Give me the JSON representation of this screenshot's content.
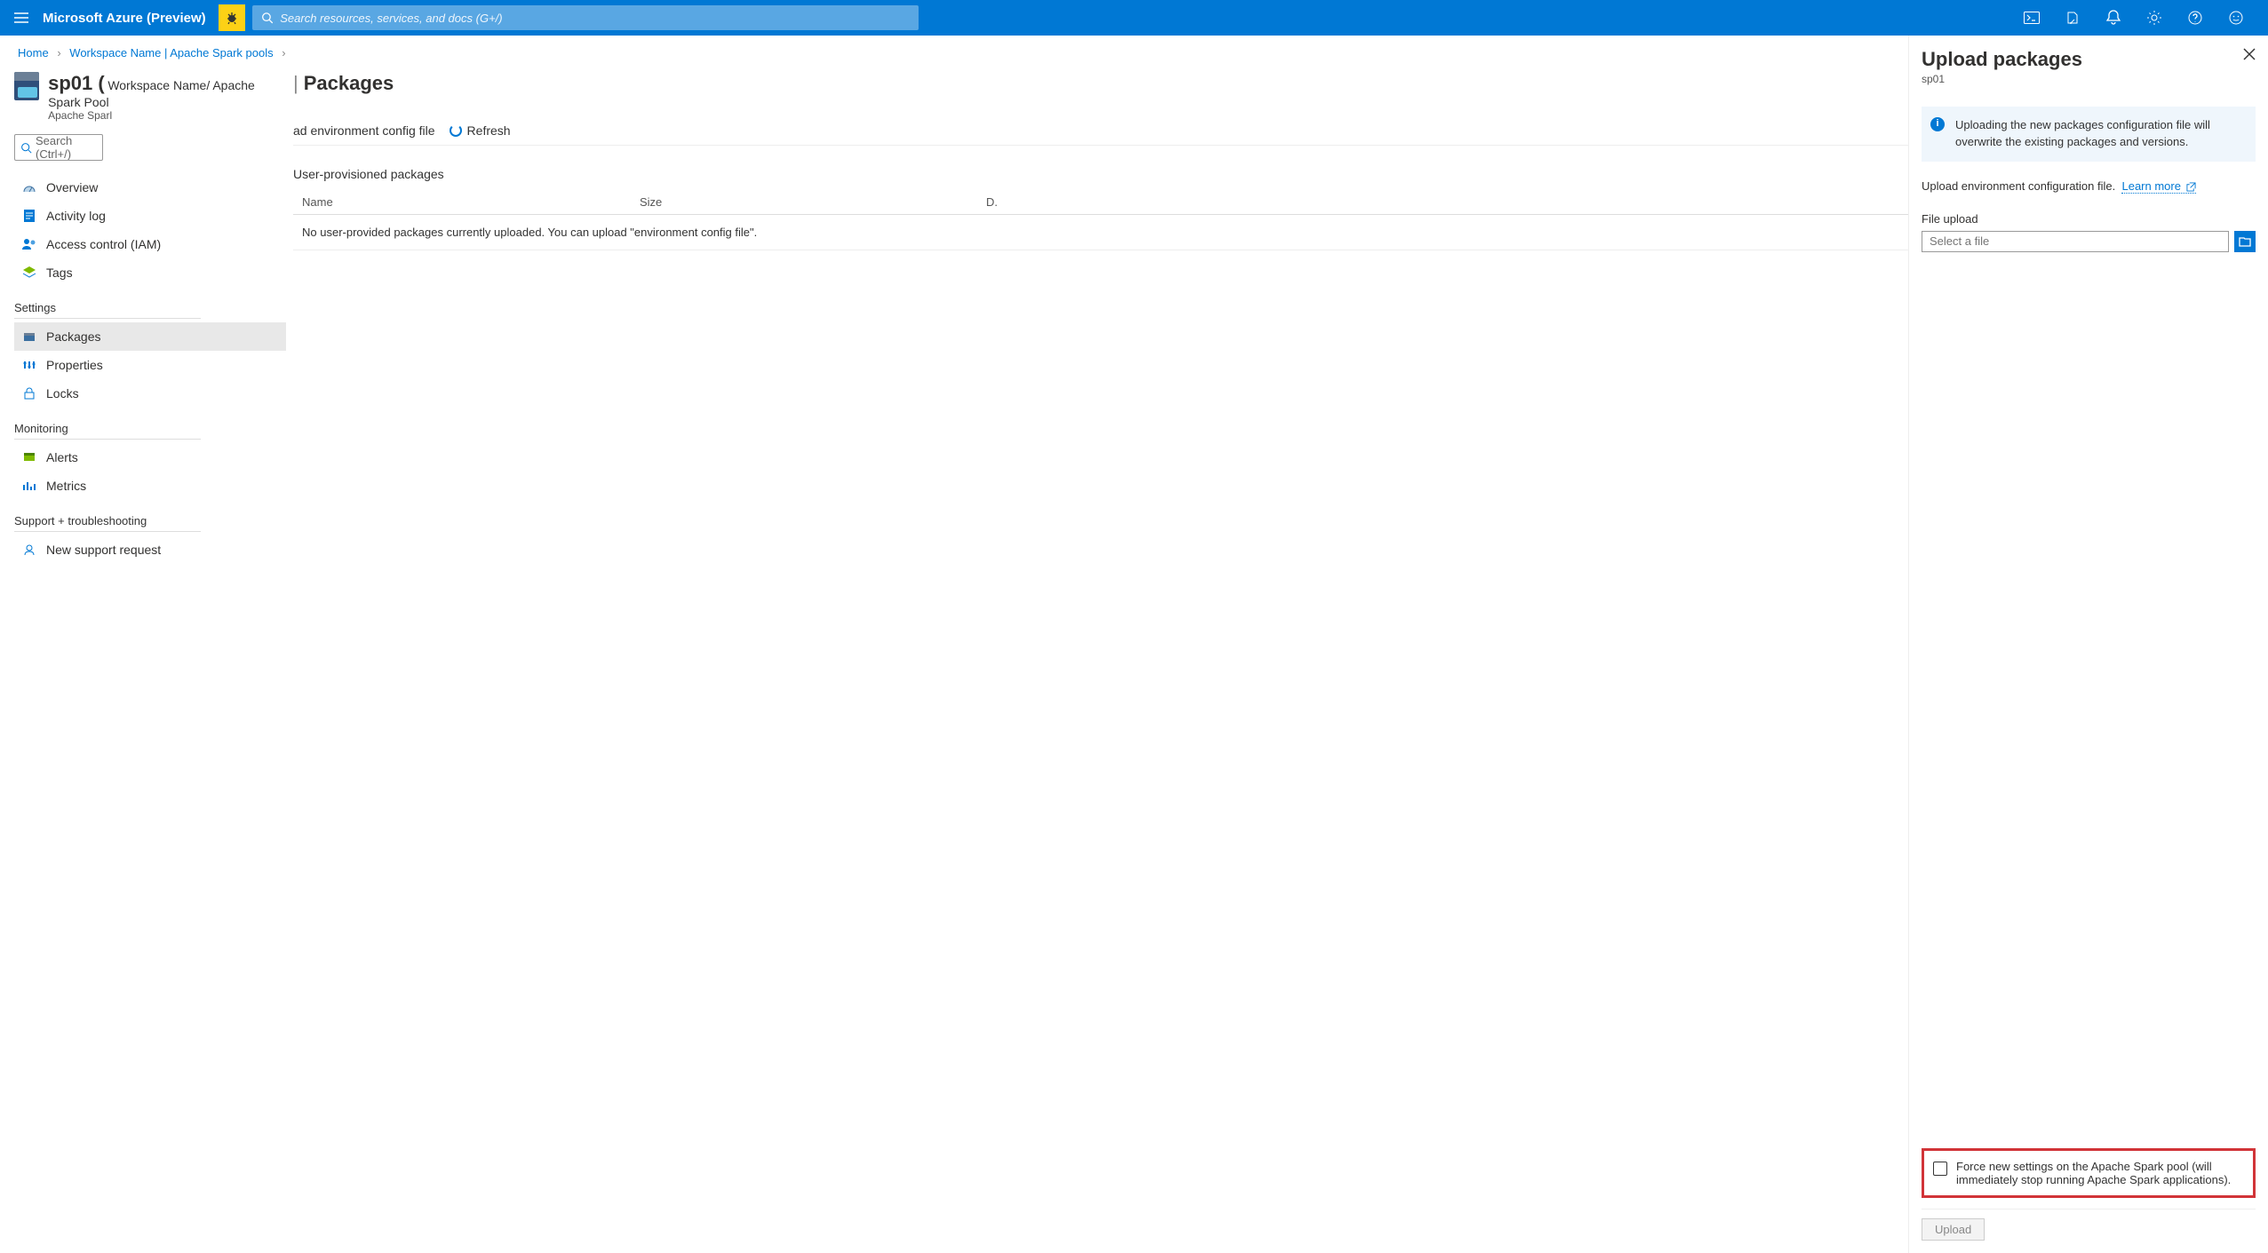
{
  "brand": "Microsoft Azure (Preview)",
  "search_placeholder": "Search resources, services, and docs (G+/)",
  "breadcrumbs": {
    "home": "Home",
    "workspace": "Workspace Name | Apache Spark pools"
  },
  "resource": {
    "name": "sp01 (",
    "suffix": " Workspace Name/ Apache Spark Pool",
    "category": "Apache Sparl"
  },
  "side_search_placeholder": "Search (Ctrl+/)",
  "nav": {
    "overview": "Overview",
    "activity": "Activity log",
    "iam": "Access control (IAM)",
    "tags": "Tags",
    "group_settings": "Settings",
    "packages": "Packages",
    "properties": "Properties",
    "locks": "Locks",
    "group_monitoring": "Monitoring",
    "alerts": "Alerts",
    "metrics": "Metrics",
    "group_support": "Support + troubleshooting",
    "support_req": "New support request"
  },
  "page": {
    "title": "Packages",
    "toolbar": {
      "upload_cfg": "ad environment config file",
      "refresh": "Refresh"
    },
    "section": "User-provisioned packages",
    "cols": {
      "name": "Name",
      "size": "Size",
      "date": "D."
    },
    "empty": "No user-provided packages currently uploaded. You can upload \"environment config file\"."
  },
  "panel": {
    "title": "Upload packages",
    "subtitle": "sp01",
    "info": "Uploading the new packages configuration file will overwrite the existing packages and versions.",
    "desc": "Upload environment configuration file.",
    "learn_more": "Learn more",
    "file_label": "File upload",
    "file_placeholder": "Select a file",
    "force_text": "Force new settings on the Apache Spark pool (will immediately stop running Apache Spark applications).",
    "upload_btn": "Upload"
  }
}
